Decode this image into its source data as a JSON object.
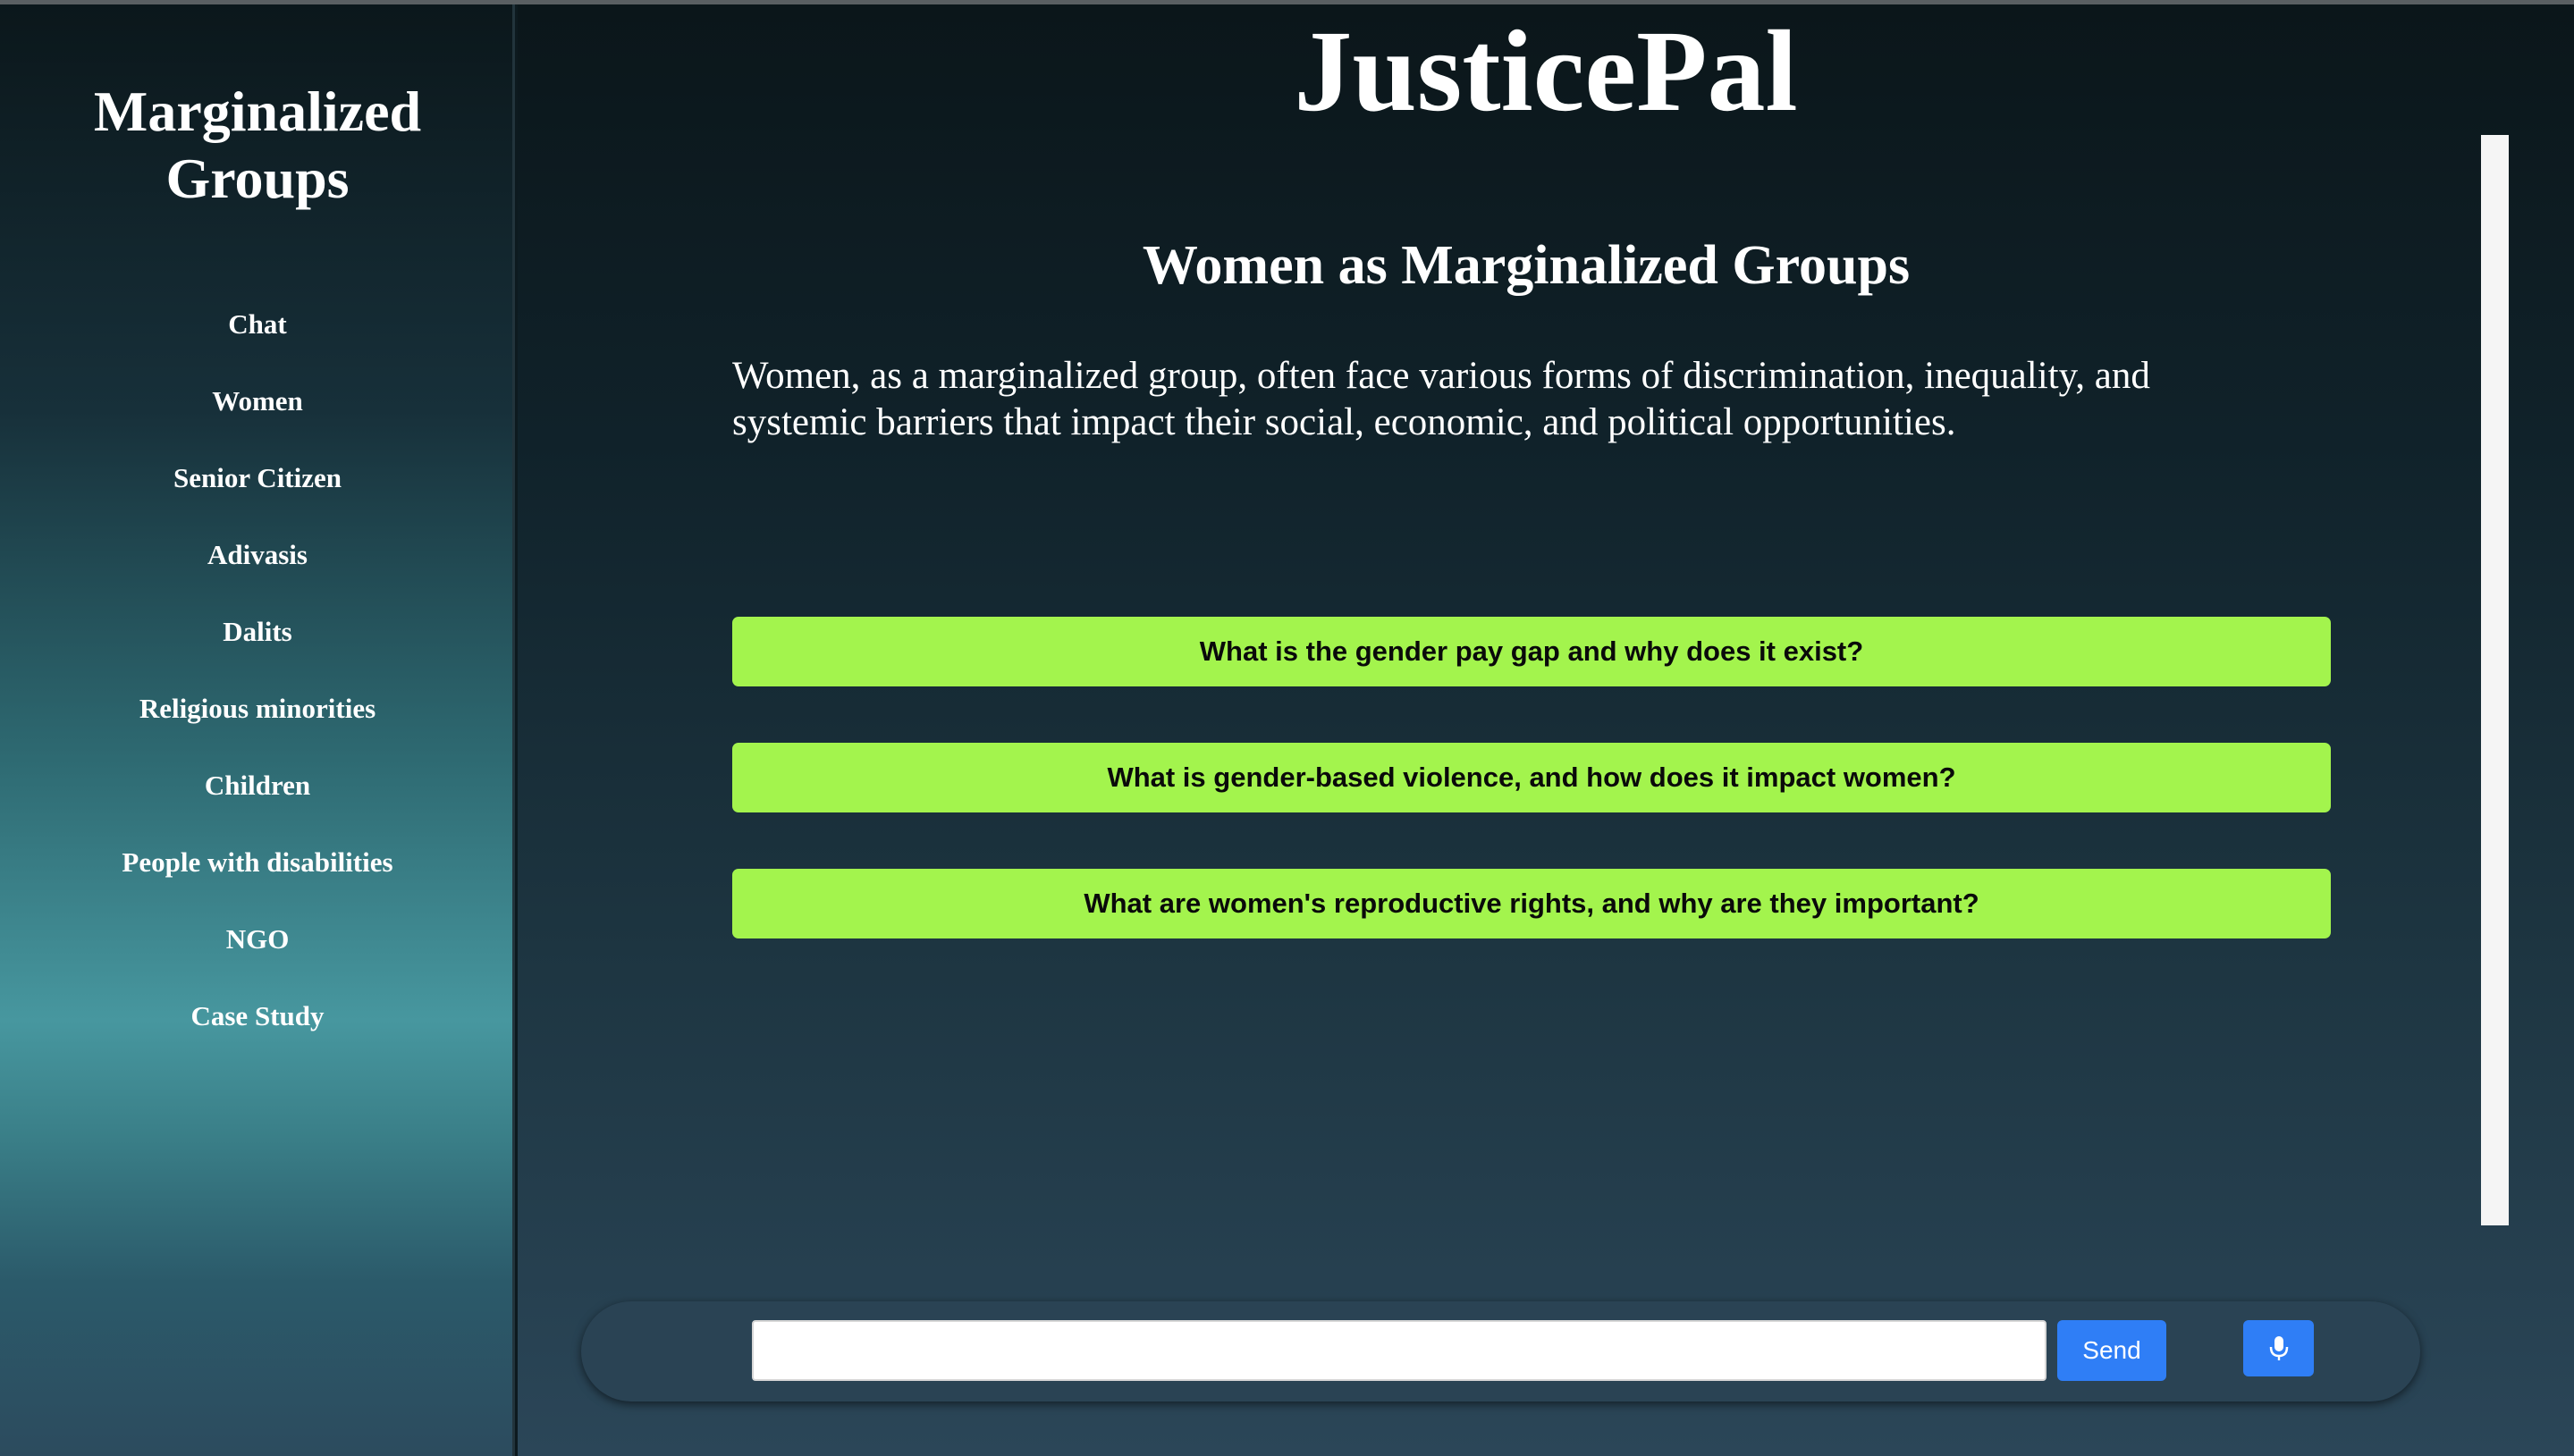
{
  "sidebar": {
    "title": "Marginalized Groups",
    "items": [
      {
        "label": "Chat"
      },
      {
        "label": "Women"
      },
      {
        "label": "Senior Citizen"
      },
      {
        "label": "Adivasis"
      },
      {
        "label": "Dalits"
      },
      {
        "label": "Religious minorities"
      },
      {
        "label": "Children"
      },
      {
        "label": "People with disabilities"
      },
      {
        "label": "NGO"
      },
      {
        "label": "Case Study"
      }
    ]
  },
  "header": {
    "title": "JusticePal"
  },
  "main": {
    "heading": "Women as Marginalized Groups",
    "description": "Women, as a marginalized group, often face various forms of discrimination, inequality, and systemic barriers that impact their social, economic, and political opportunities.",
    "questions": [
      {
        "label": "What is the gender pay gap and why does it exist?"
      },
      {
        "label": "What is gender-based violence, and how does it impact women?"
      },
      {
        "label": "What are women's reproductive rights, and why are they important?"
      }
    ]
  },
  "chat": {
    "input_value": "",
    "input_placeholder": "",
    "send_label": "Send",
    "mic_icon": "microphone-icon"
  },
  "colors": {
    "question_button": "#a3f44d",
    "send_button": "#2f7ef6",
    "text": "#ffffff"
  }
}
